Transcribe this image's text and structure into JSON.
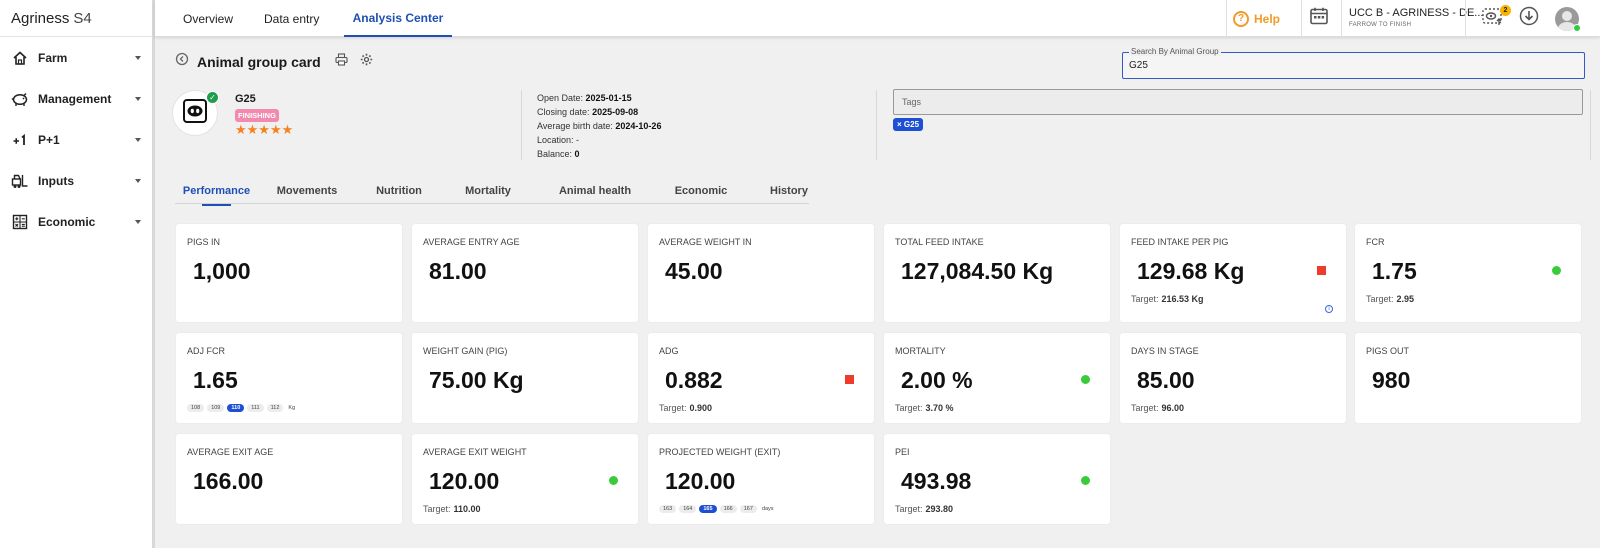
{
  "app": {
    "name": "Agriness",
    "version_label": "S4"
  },
  "sidebar": {
    "items": [
      {
        "label": "Farm",
        "icon": "home-icon"
      },
      {
        "label": "Management",
        "icon": "piggy-bank-icon"
      },
      {
        "label": "P+1",
        "icon": "plus-one-icon"
      },
      {
        "label": "Inputs",
        "icon": "forklift-icon"
      },
      {
        "label": "Economic",
        "icon": "calculator-icon"
      }
    ]
  },
  "topbar": {
    "tabs": [
      {
        "label": "Overview"
      },
      {
        "label": "Data entry"
      },
      {
        "label": "Analysis Center",
        "active": true
      }
    ],
    "help_label": "Help",
    "org_title": "UCC B - AGRINESS - DE...",
    "org_subtitle": "FARROW TO FINISH",
    "notification_count": "2"
  },
  "page": {
    "title": "Animal group card",
    "search": {
      "legend": "Search By Animal Group",
      "value": "G25"
    }
  },
  "group": {
    "name": "G25",
    "stage": "FINISHING",
    "stars": "★★★★★",
    "info": [
      {
        "label": "Open Date:",
        "value": "2025-01-15"
      },
      {
        "label": "Closing date:",
        "value": "2025-09-08"
      },
      {
        "label": "Average birth date:",
        "value": "2024-10-26"
      },
      {
        "label": "Location:",
        "value": "-"
      },
      {
        "label": "Balance:",
        "value": "0"
      }
    ]
  },
  "tags": {
    "placeholder": "Tags",
    "chip": "× G25"
  },
  "tabs": [
    {
      "label": "Performance",
      "active": true
    },
    {
      "label": "Movements"
    },
    {
      "label": "Nutrition"
    },
    {
      "label": "Mortality"
    },
    {
      "label": "Animal health"
    },
    {
      "label": "Economic"
    },
    {
      "label": "History"
    }
  ],
  "status_colors": {
    "good": "#3acb3a",
    "bad": "#ef3b2c",
    "accent": "#1e4fb4"
  },
  "cards": [
    {
      "label": "PIGS IN",
      "value": "1,000"
    },
    {
      "label": "AVERAGE ENTRY AGE",
      "value": "81.00"
    },
    {
      "label": "AVERAGE WEIGHT IN",
      "value": "45.00"
    },
    {
      "label": "TOTAL FEED INTAKE",
      "value": "127,084.50 Kg"
    },
    {
      "label": "FEED INTAKE PER PIG",
      "value": "129.68 Kg",
      "target_label": "Target:",
      "target": "216.53 Kg",
      "status": "bad"
    },
    {
      "label": "FCR",
      "value": "1.75",
      "target_label": "Target:",
      "target": "2.95",
      "status": "good"
    },
    {
      "label": "ADJ FCR",
      "value": "1.65",
      "chips": [
        "108",
        "109",
        "110",
        "111",
        "112"
      ],
      "chips_selected": "110",
      "chips_unit": "Kg"
    },
    {
      "label": "WEIGHT GAIN (PIG)",
      "value": "75.00 Kg"
    },
    {
      "label": "ADG",
      "value": "0.882",
      "target_label": "Target:",
      "target": "0.900",
      "status": "bad"
    },
    {
      "label": "MORTALITY",
      "value": "2.00 %",
      "target_label": "Target:",
      "target": "3.70 %",
      "status": "good"
    },
    {
      "label": "DAYS IN STAGE",
      "value": "85.00",
      "target_label": "Target:",
      "target": "96.00"
    },
    {
      "label": "PIGS OUT",
      "value": "980"
    },
    {
      "label": "AVERAGE EXIT AGE",
      "value": "166.00"
    },
    {
      "label": "AVERAGE EXIT WEIGHT",
      "value": "120.00",
      "target_label": "Target:",
      "target": "110.00",
      "status": "good"
    },
    {
      "label": "PROJECTED WEIGHT (EXIT)",
      "value": "120.00",
      "chips": [
        "163",
        "164",
        "165",
        "166",
        "167"
      ],
      "chips_selected": "165",
      "chips_unit": "days"
    },
    {
      "label": "PEI",
      "value": "493.98",
      "target_label": "Target:",
      "target": "293.80",
      "status": "good"
    }
  ]
}
